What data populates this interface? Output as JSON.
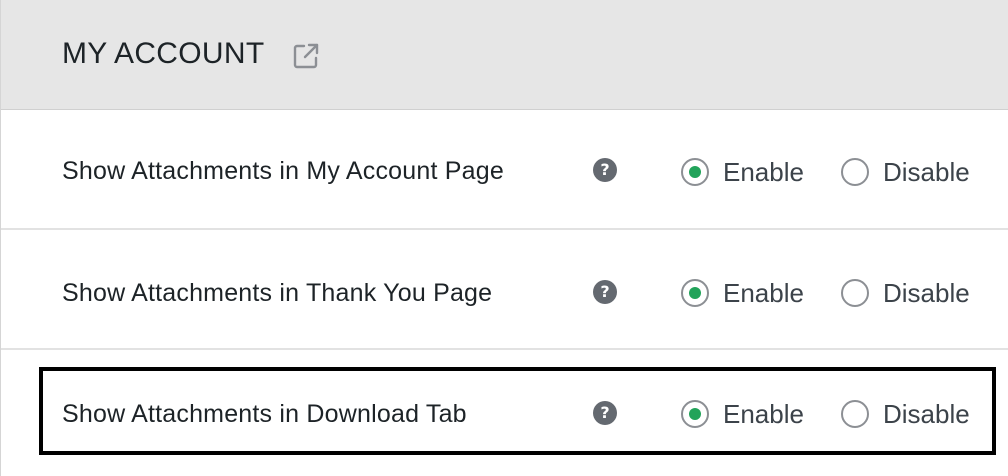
{
  "section": {
    "title": "MY ACCOUNT",
    "icon": "external-link-icon"
  },
  "settings": [
    {
      "label": "Show Attachments in My Account Page",
      "help": "?",
      "options": [
        "Enable",
        "Disable"
      ],
      "selected": "Enable"
    },
    {
      "label": "Show Attachments in Thank You Page",
      "help": "?",
      "options": [
        "Enable",
        "Disable"
      ],
      "selected": "Enable"
    },
    {
      "label": "Show Attachments in Download Tab",
      "help": "?",
      "options": [
        "Enable",
        "Disable"
      ],
      "selected": "Enable",
      "highlighted": true
    }
  ],
  "colors": {
    "radio_checked": "#22a35a",
    "header_bg": "#e6e6e6",
    "highlight_border": "#000000"
  }
}
